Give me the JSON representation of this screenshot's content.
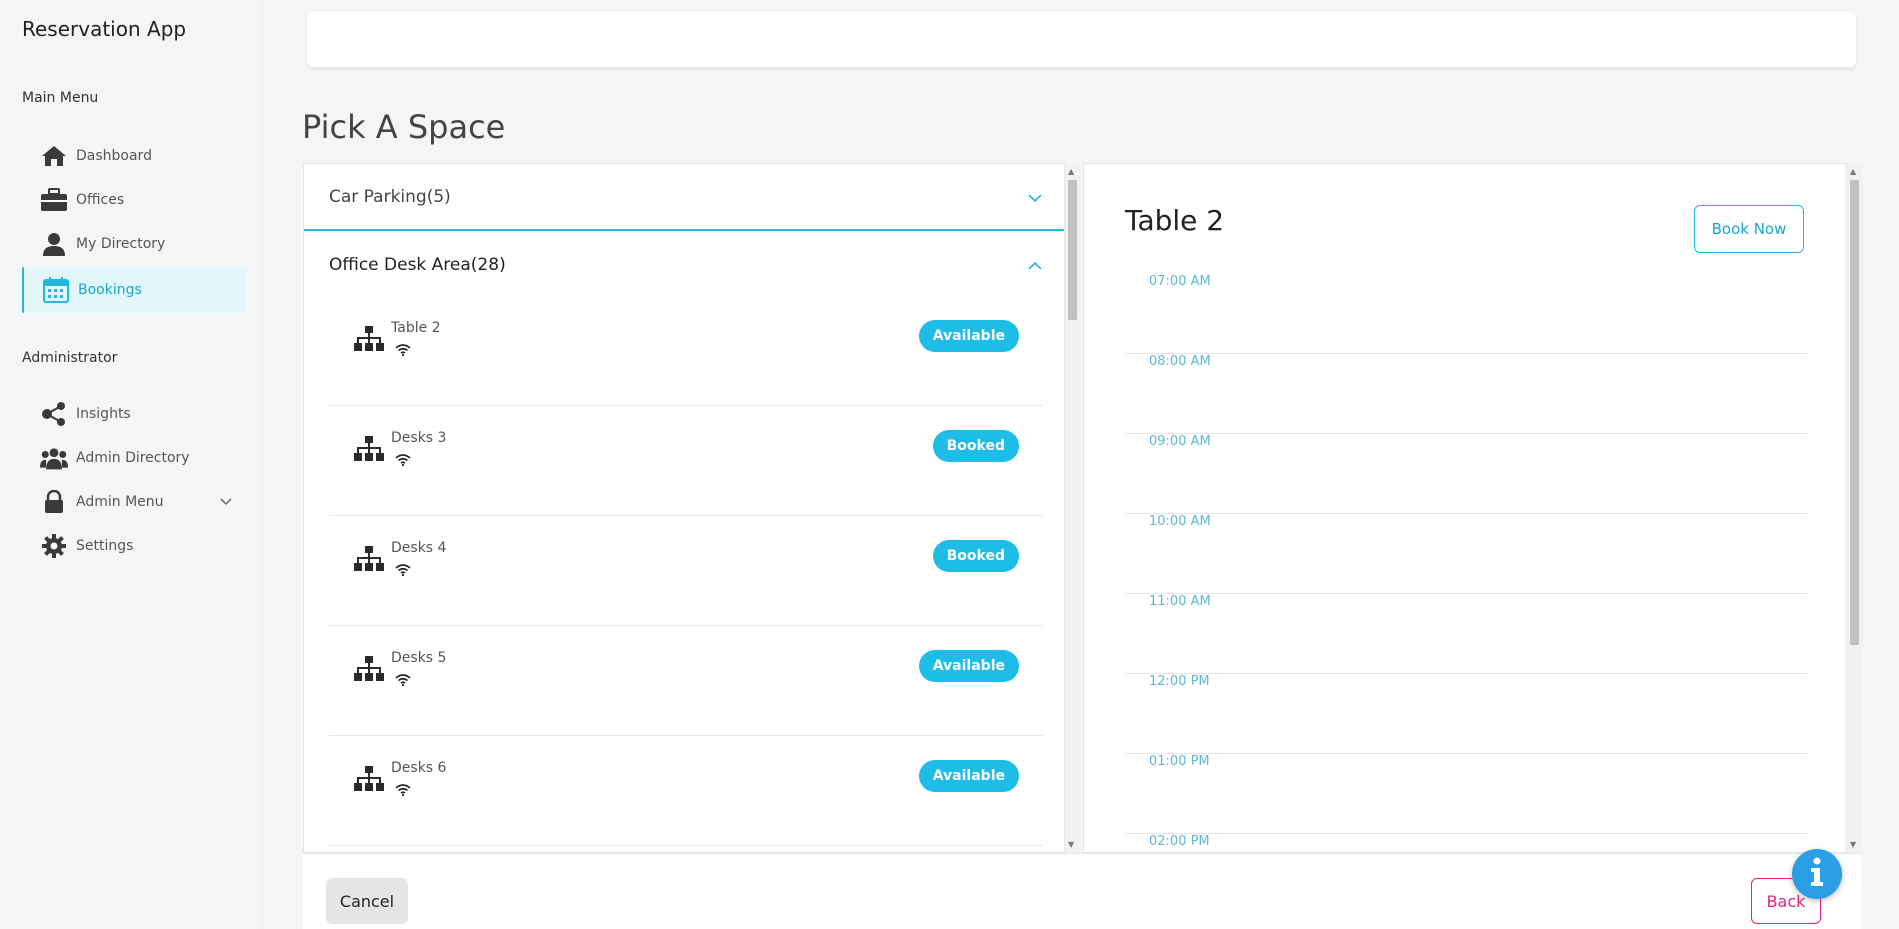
{
  "app": {
    "title": "Reservation App"
  },
  "sidebar": {
    "main_menu_label": "Main Menu",
    "admin_label": "Administrator",
    "main_items": [
      {
        "label": "Dashboard",
        "icon": "home-icon"
      },
      {
        "label": "Offices",
        "icon": "briefcase-icon"
      },
      {
        "label": "My Directory",
        "icon": "user-icon"
      },
      {
        "label": "Bookings",
        "icon": "calendar-icon",
        "active": true
      }
    ],
    "admin_items": [
      {
        "label": "Insights",
        "icon": "share-icon"
      },
      {
        "label": "Admin Directory",
        "icon": "users-icon"
      },
      {
        "label": "Admin Menu",
        "icon": "lock-icon"
      },
      {
        "label": "Settings",
        "icon": "gear-icon"
      }
    ]
  },
  "page": {
    "title": "Pick A Space"
  },
  "spaces": {
    "categories": [
      {
        "label": "Car Parking(5)",
        "expanded": false
      },
      {
        "label": "Office Desk Area(28)",
        "expanded": true
      }
    ],
    "desks": [
      {
        "name": "Table 2",
        "status": "Available"
      },
      {
        "name": "Desks 3",
        "status": "Booked"
      },
      {
        "name": "Desks 4",
        "status": "Booked"
      },
      {
        "name": "Desks 5",
        "status": "Available"
      },
      {
        "name": "Desks 6",
        "status": "Available"
      }
    ]
  },
  "detail": {
    "title": "Table 2",
    "book_label": "Book Now",
    "slots": [
      "07:00 AM",
      "08:00 AM",
      "09:00 AM",
      "10:00 AM",
      "11:00 AM",
      "12:00 PM",
      "01:00 PM",
      "02:00 PM"
    ]
  },
  "footer": {
    "cancel_label": "Cancel",
    "back_label": "Back"
  },
  "colors": {
    "accent": "#1dbde8",
    "back": "#e0257a",
    "fab": "#2b9fe6"
  }
}
